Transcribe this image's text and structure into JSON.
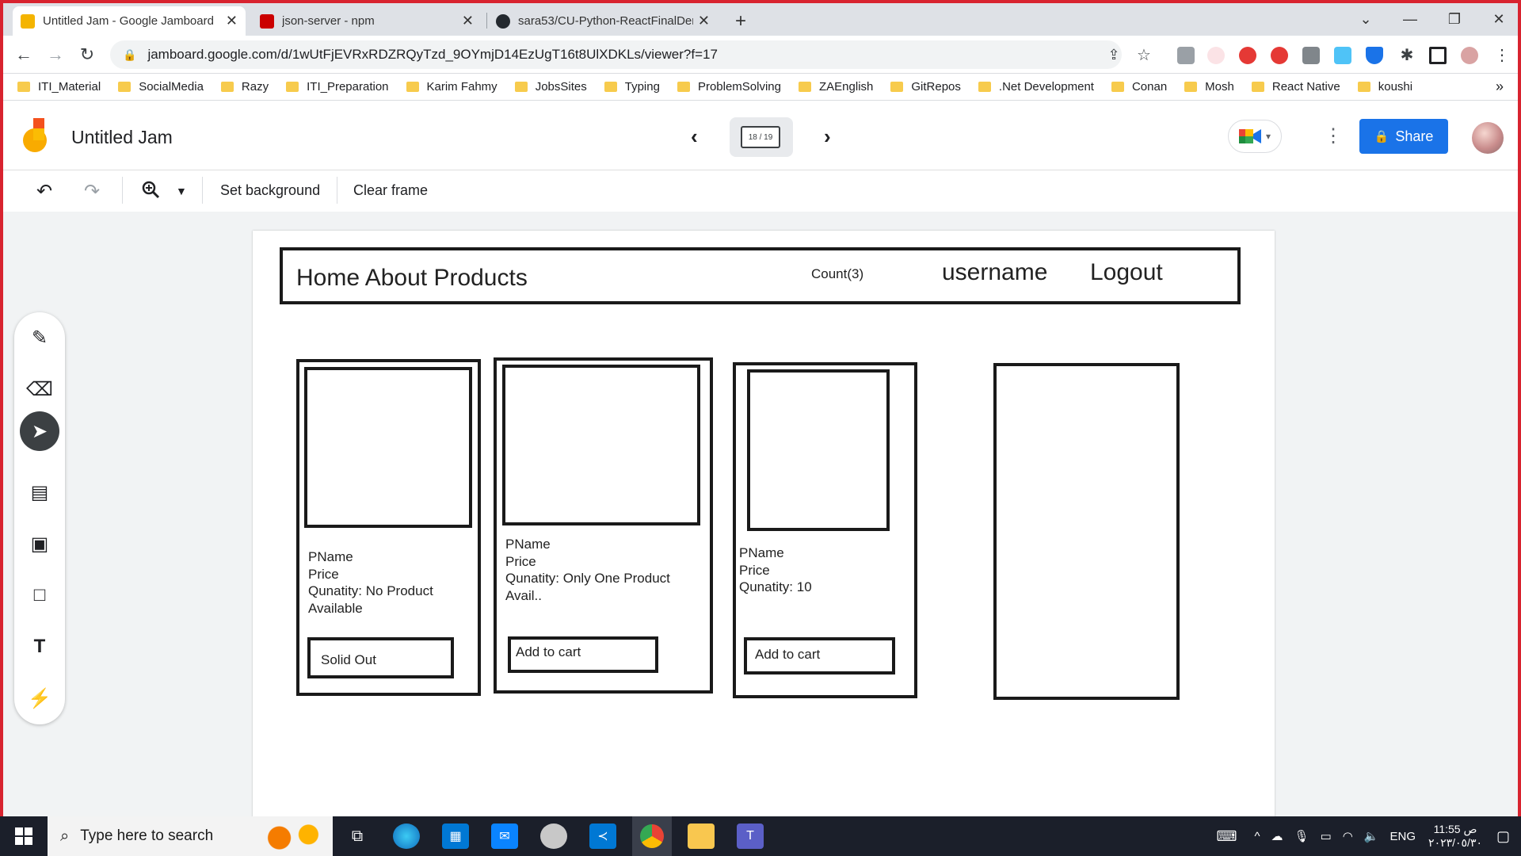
{
  "browser": {
    "tabs": [
      {
        "title": "Untitled Jam - Google Jamboard",
        "favicon_color": "#f4b400",
        "active": true
      },
      {
        "title": "json-server - npm",
        "favicon_color": "#cb0000",
        "active": false
      },
      {
        "title": "sara53/CU-Python-ReactFinalDem",
        "favicon_color": "#24292f",
        "active": false
      }
    ],
    "new_tab_label": "+",
    "url": "jamboard.google.com/d/1wUtFjEVRxRDZRQyTzd_9OYmjD14EzUgT16t8UlXDKLs/viewer?f=17",
    "bookmarks": [
      "ITI_Material",
      "SocialMedia",
      "Razy",
      "ITI_Preparation",
      "Karim Fahmy",
      "JobsSites",
      "Typing",
      "ProblemSolving",
      "ZAEnglish",
      "GitRepos",
      ".Net Development",
      "Conan",
      "Mosh",
      "React Native",
      "koushi"
    ],
    "bookmarks_overflow": "»"
  },
  "jamboard": {
    "title": "Untitled Jam",
    "frame_counter": "18 / 19",
    "share_label": "Share",
    "toolbar": {
      "set_background": "Set background",
      "clear_frame": "Clear frame"
    },
    "tools": [
      "pen-icon",
      "eraser-icon",
      "select-icon",
      "sticky-note-icon",
      "image-icon",
      "shape-icon",
      "text-box-icon",
      "laser-icon"
    ],
    "selected_tool": "select-icon"
  },
  "sketch": {
    "nav_links": "Home About Products",
    "count": "Count(3)",
    "username": "username",
    "logout": "Logout",
    "cards": [
      {
        "name": "PName",
        "price": "Price",
        "quantity_line1": "Qunatity: No Product",
        "quantity_line2": "Available",
        "button": "Solid Out"
      },
      {
        "name": "PName",
        "price": "Price",
        "quantity_line1": "Qunatity: Only One Product",
        "quantity_line2": "Avail..",
        "button": "Add to cart"
      },
      {
        "name": "PName",
        "price": "Price",
        "quantity_line1": "Qunatity: 10",
        "quantity_line2": "",
        "button": "Add to cart"
      }
    ]
  },
  "taskbar": {
    "search_placeholder": "Type here to search",
    "language": "ENG",
    "time": "11:55 ص",
    "date": "٢٠٢٣/٠٥/٣٠"
  }
}
